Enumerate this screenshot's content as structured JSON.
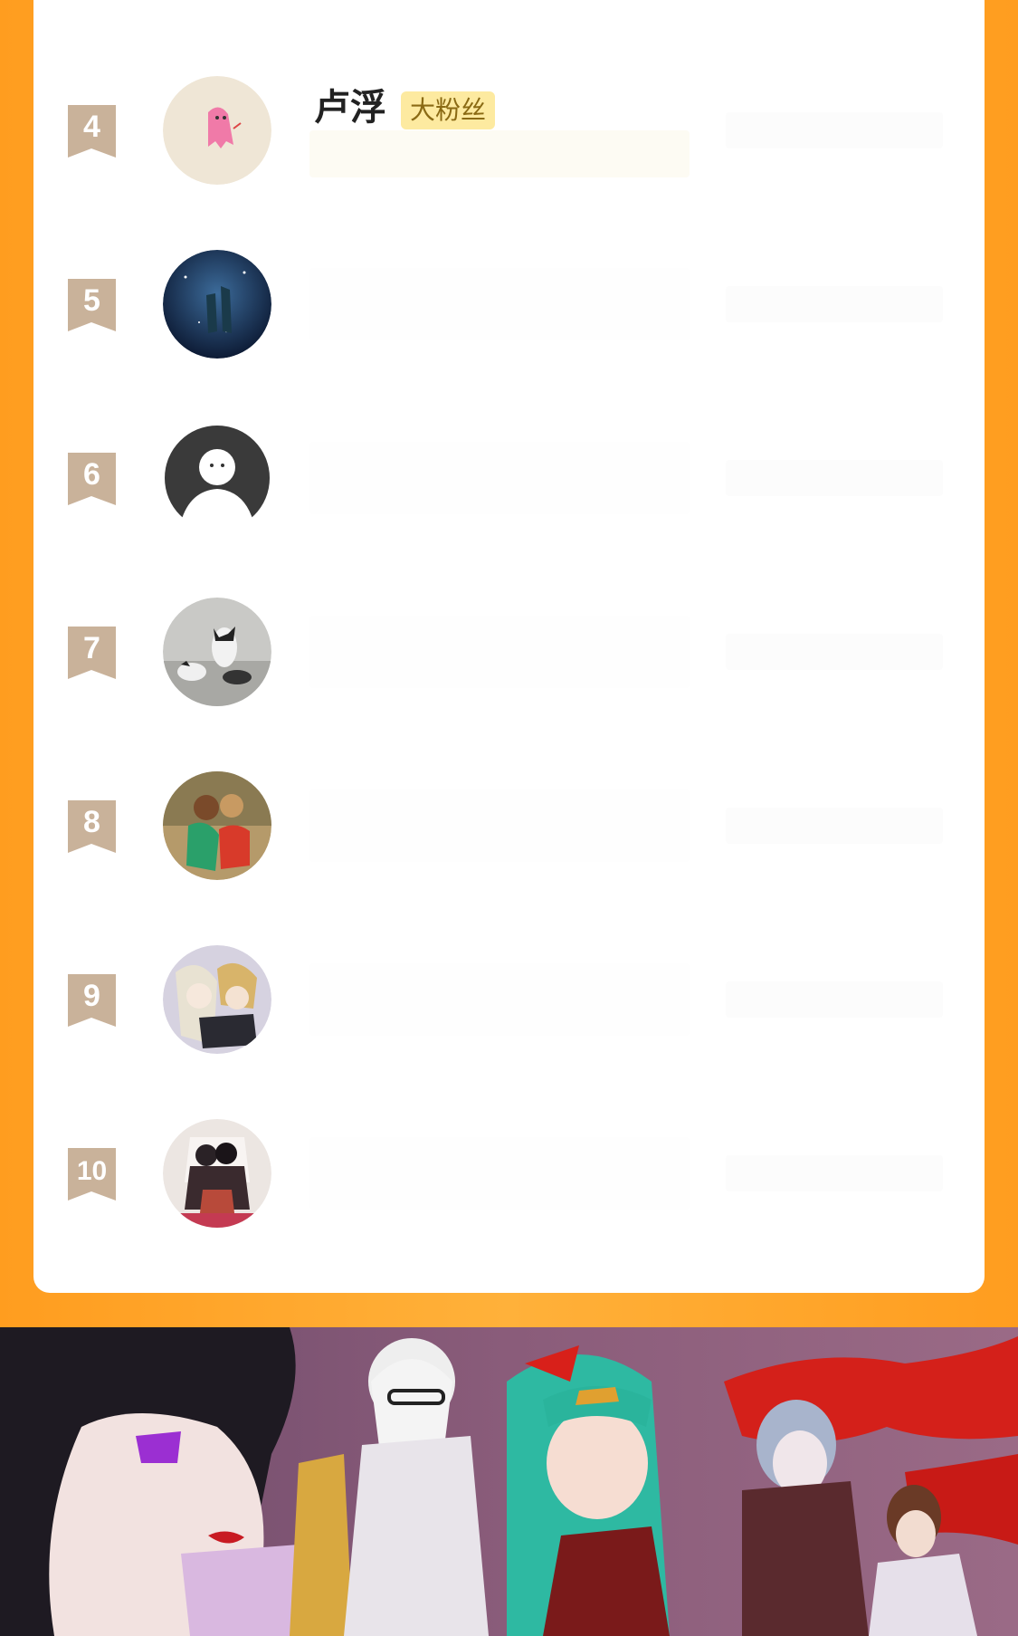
{
  "ranking": {
    "entries": [
      {
        "rank": "4",
        "name": "卢浮",
        "badge": "大粉丝",
        "avatar_icon": "pink-ghost-avatar"
      },
      {
        "rank": "5",
        "name": "",
        "badge": "",
        "avatar_icon": "starry-sky-avatar"
      },
      {
        "rank": "6",
        "name": "",
        "badge": "",
        "avatar_icon": "default-user-avatar"
      },
      {
        "rank": "7",
        "name": "",
        "badge": "",
        "avatar_icon": "cats-avatar"
      },
      {
        "rank": "8",
        "name": "",
        "badge": "",
        "avatar_icon": "couple-photo-avatar"
      },
      {
        "rank": "9",
        "name": "",
        "badge": "",
        "avatar_icon": "anime-couple-avatar"
      },
      {
        "rank": "10",
        "name": "",
        "badge": "",
        "avatar_icon": "couple-hug-avatar"
      }
    ]
  },
  "colors": {
    "background_orange": "#ff9d1f",
    "card": "#ffffff",
    "rank_ribbon": "#c9b29a",
    "badge_bg": "#fdeaa0",
    "badge_text": "#8a6a14"
  },
  "banner": {
    "icon": "comic-characters-banner"
  }
}
